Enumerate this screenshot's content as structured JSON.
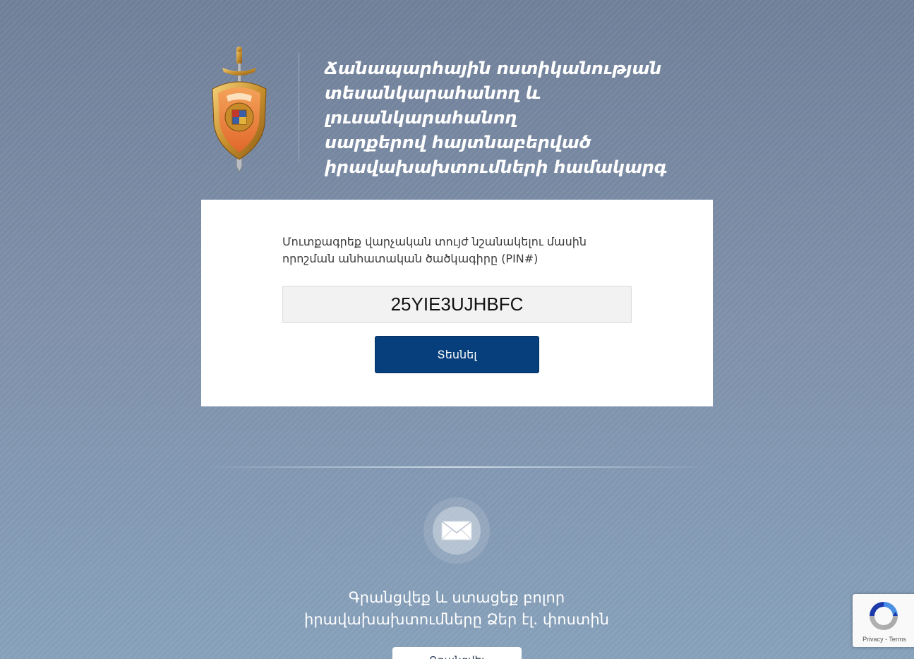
{
  "header": {
    "title_lines": [
      "Ճանապարհային ոստիկանության",
      "տեսանկարահանող և լուսանկարահանող",
      "սարքերով հայտնաբերված",
      "իրավախախտումների համակարգ"
    ]
  },
  "pin_form": {
    "instruction_lines": [
      "Մուտքագրեք վարչական տույժ նշանակելու մասին",
      "որոշման անհատական ծածկագիրը (PIN#)"
    ],
    "pin_value": "25YIE3UJHBFC",
    "submit_label": "Տեսնել"
  },
  "subscribe": {
    "text_lines": [
      "Գրանցվեք և ստացեք բոլոր",
      "իրավախախտումները Ձեր էլ. փոստին"
    ],
    "button_label": "Գրանցվել"
  },
  "recaptcha": {
    "privacy_label": "Privacy",
    "separator": " - ",
    "terms_label": "Terms"
  },
  "colors": {
    "primary_button": "#063f7c",
    "background": "#7c8ca5"
  },
  "icons": {
    "emblem": "police-emblem-icon",
    "mail": "envelope-icon",
    "recaptcha": "recaptcha-logo-icon"
  }
}
